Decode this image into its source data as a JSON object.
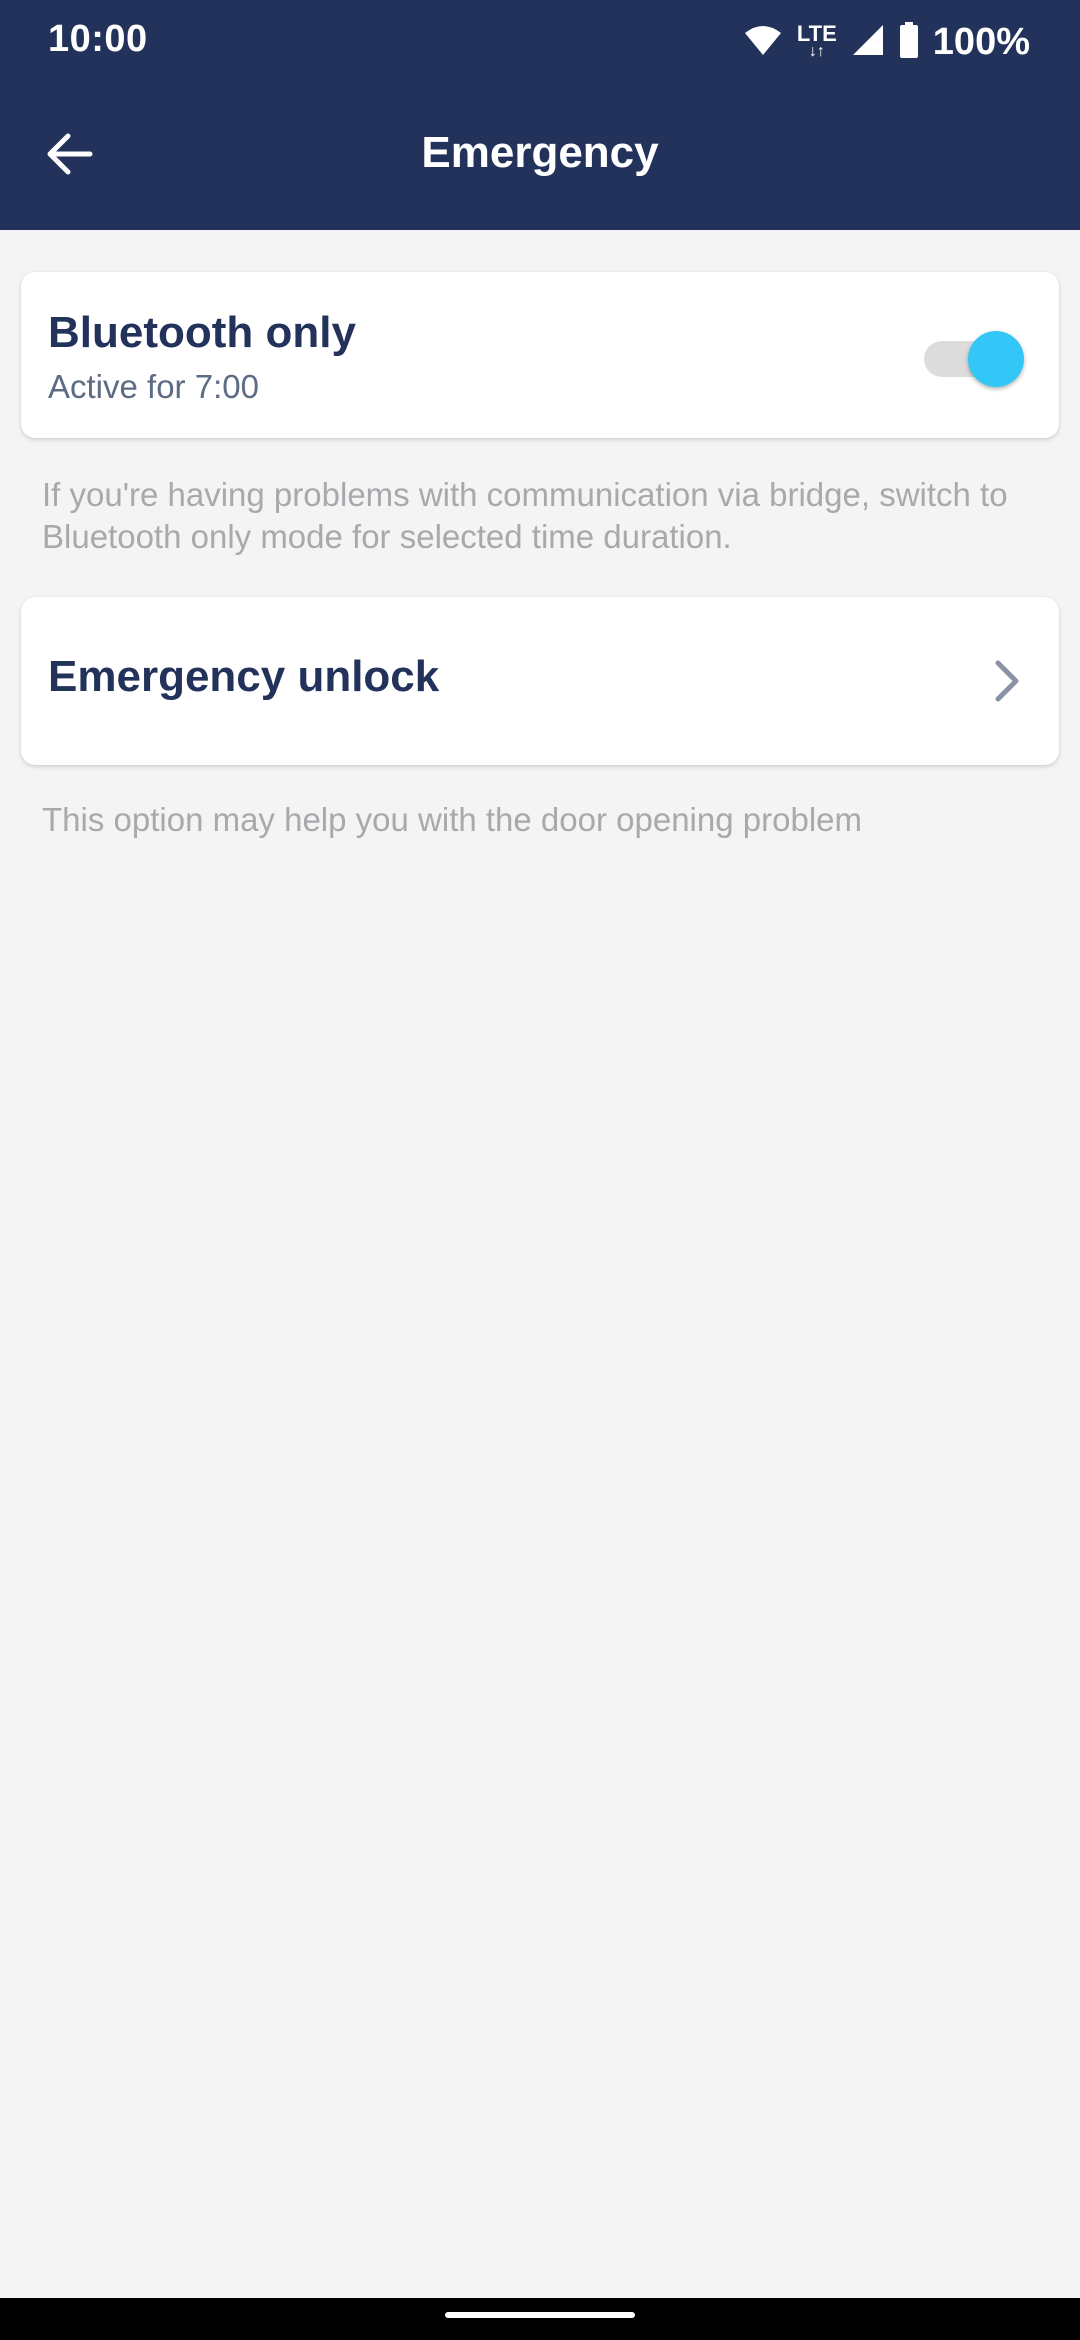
{
  "status_bar": {
    "time": "10:00",
    "network": "LTE",
    "battery": "100%",
    "icons": [
      "wifi-icon",
      "lte-icon",
      "signal-icon",
      "battery-icon"
    ]
  },
  "header": {
    "title": "Emergency",
    "back_icon": "arrow-left-icon",
    "background_color": "#22325a"
  },
  "bluetooth_card": {
    "title": "Bluetooth only",
    "subtitle": "Active for 7:00",
    "toggle_on": true,
    "toggle_color": "#33c7f7"
  },
  "bluetooth_note": "If you're having problems with communication via bridge, switch to Bluetooth only mode for selected time duration.",
  "emergency_card": {
    "title": "Emergency unlock",
    "chevron_icon": "chevron-right-icon"
  },
  "emergency_note": "This option may help you with the door opening problem"
}
